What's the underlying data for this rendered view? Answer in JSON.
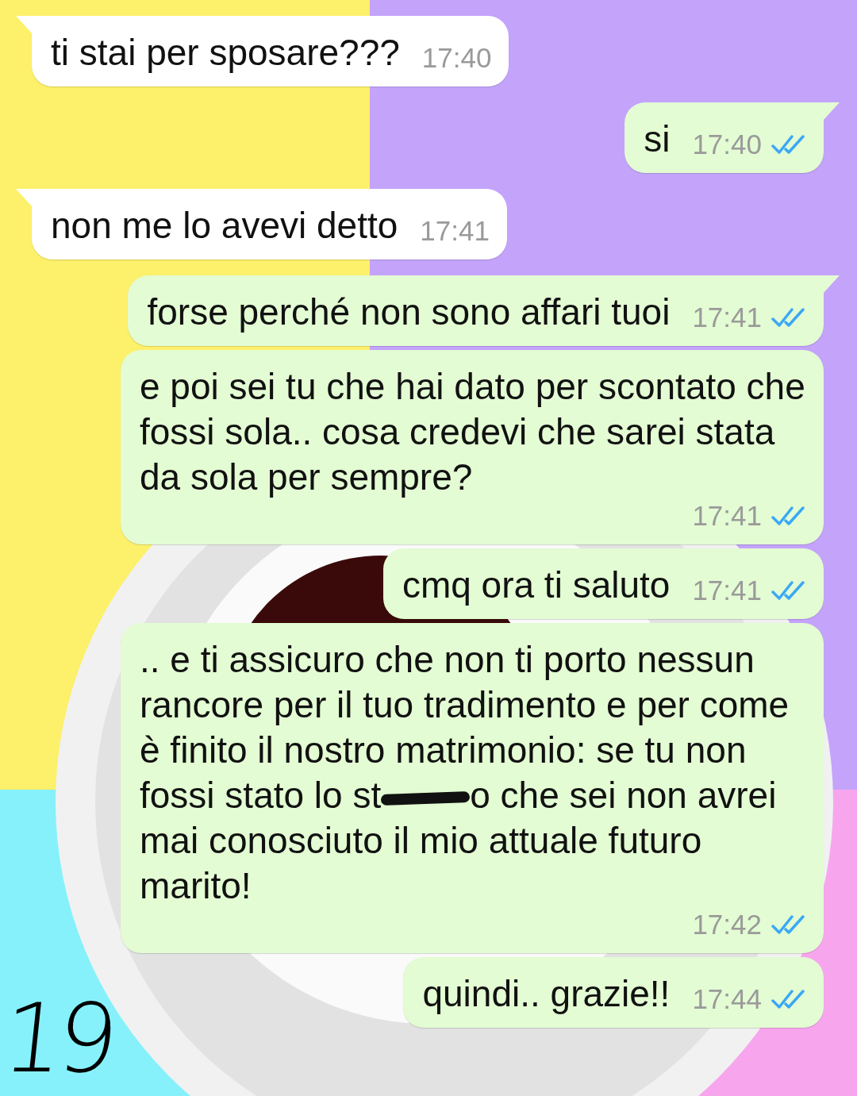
{
  "messages": [
    {
      "kind": "incoming",
      "tail": true,
      "text": "ti stai per sposare???",
      "time": "17:40"
    },
    {
      "kind": "outgoing",
      "tail": true,
      "text": "si",
      "time": "17:40",
      "read": true
    },
    {
      "kind": "incoming",
      "tail": true,
      "text": "non me lo avevi detto",
      "time": "17:41"
    },
    {
      "kind": "outgoing",
      "tail": true,
      "text": "forse perché non sono affari tuoi",
      "time": "17:41",
      "read": true
    },
    {
      "kind": "outgoing",
      "tail": false,
      "text": "e poi sei tu che hai dato per scontato che fossi sola.. cosa credevi che sarei stata da sola per sempre?",
      "time": "17:41",
      "read": true
    },
    {
      "kind": "outgoing",
      "tail": false,
      "text": "cmq ora ti saluto",
      "time": "17:41",
      "read": true
    },
    {
      "kind": "outgoing",
      "tail": false,
      "segments": [
        {
          "kind": "text",
          "text": ".. e ti assicuro che non ti porto nessun rancore per il tuo tradimento e per come è finito il nostro matrimonio: se tu non fossi stato lo st"
        },
        {
          "kind": "redacted"
        },
        {
          "kind": "text",
          "text": "o che sei non avrei mai conosciuto il mio attuale futuro marito!"
        }
      ],
      "time": "17:42",
      "read": true
    },
    {
      "kind": "outgoing",
      "tail": false,
      "text": "quindi.. grazie!!",
      "time": "17:44",
      "read": true
    }
  ],
  "annotation": "19"
}
